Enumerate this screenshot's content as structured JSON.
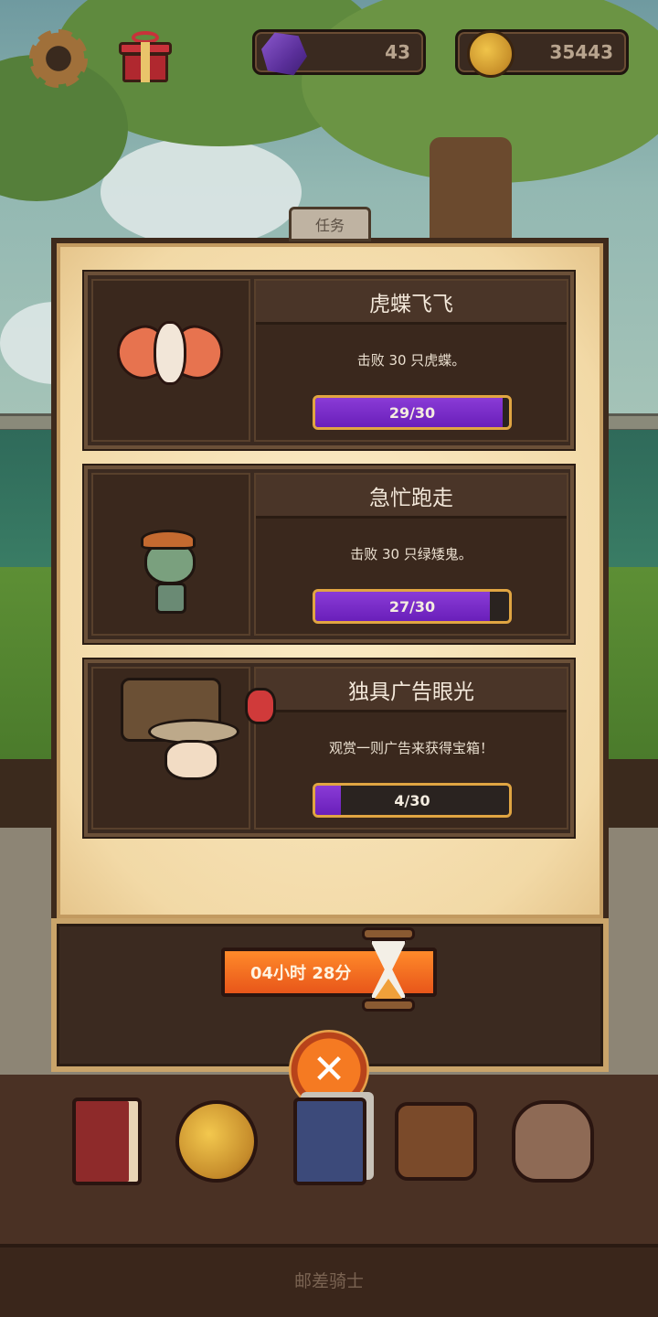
{
  "hud": {
    "gems": "43",
    "coins": "35443",
    "settings_icon": "gear-icon",
    "gift_icon": "gift-icon"
  },
  "panel": {
    "tab_label": "任务",
    "quests": [
      {
        "title": "虎蝶飞飞",
        "description": "击败 30 只虎蝶。",
        "progress_text": "29/30",
        "progress": 0.967,
        "portrait": "moth-creature"
      },
      {
        "title": "急忙跑走",
        "description": "击败 30 只绿矮鬼。",
        "progress_text": "27/30",
        "progress": 0.9,
        "portrait": "green-goblin"
      },
      {
        "title": "独具广告眼光",
        "description": "观赏一则广告来获得宝箱！",
        "progress_text": "4/30",
        "progress": 0.133,
        "portrait": "traveling-merchant"
      }
    ],
    "timer": "04小时 28分",
    "close_icon": "close-icon"
  },
  "bottom_nav": {
    "items": [
      "book-icon",
      "star-coin-icon",
      "card-deck-icon",
      "satchel-icon",
      "treasure-sack-icon"
    ]
  },
  "footer": {
    "title": "邮差骑士"
  },
  "colors": {
    "progress_fill": "#7a2fcc",
    "progress_border": "#e0a542",
    "timer_orange": "#f57a22",
    "panel_parchment": "#f2d9a6",
    "quest_bg": "#3a281d"
  }
}
